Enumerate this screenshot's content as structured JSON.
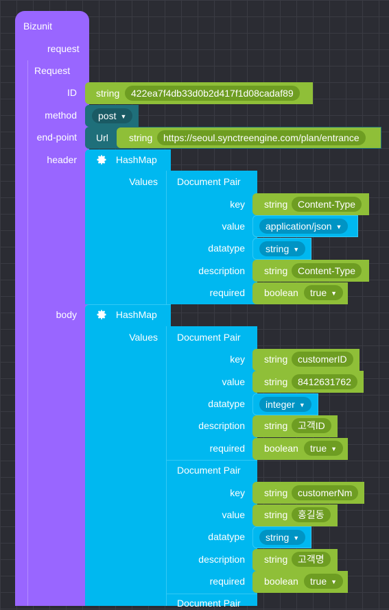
{
  "bizunit": {
    "title": "Bizunit",
    "request_label": "request"
  },
  "request": {
    "title": "Request",
    "id_label": "ID",
    "id_type": "string",
    "id_value": "422ea7f4db33d0b2d417f1d08cadaf89",
    "method_label": "method",
    "method_value": "post",
    "endpoint_label": "end-point",
    "endpoint_kind": "Url",
    "endpoint_type": "string",
    "endpoint_value": "https://seoul.synctreengine.com/plan/entrance",
    "header_label": "header",
    "body_label": "body"
  },
  "hashmap": {
    "title": "HashMap",
    "values_label": "Values"
  },
  "pair": {
    "title": "Document Pair",
    "key_label": "key",
    "value_label": "value",
    "datatype_label": "datatype",
    "description_label": "description",
    "required_label": "required"
  },
  "types": {
    "string": "string",
    "boolean": "boolean"
  },
  "header_pair": {
    "key": "Content-Type",
    "value": "application/json",
    "datatype": "string",
    "description": "Content-Type",
    "required": "true"
  },
  "body_pairs": [
    {
      "key": "customerID",
      "value": "8412631762",
      "datatype": "integer",
      "description": "고객ID",
      "required": "true"
    },
    {
      "key": "customerNm",
      "value": "홍길동",
      "datatype": "string",
      "description": "고객명",
      "required": "true"
    }
  ],
  "colors": {
    "purple": "#9966ff",
    "blue": "#00b8f0",
    "green": "#8fbf38",
    "teal": "#1f6f7a"
  },
  "icons": {
    "hashmap": "gear-icon",
    "dropdown": "triangle-down-icon"
  }
}
